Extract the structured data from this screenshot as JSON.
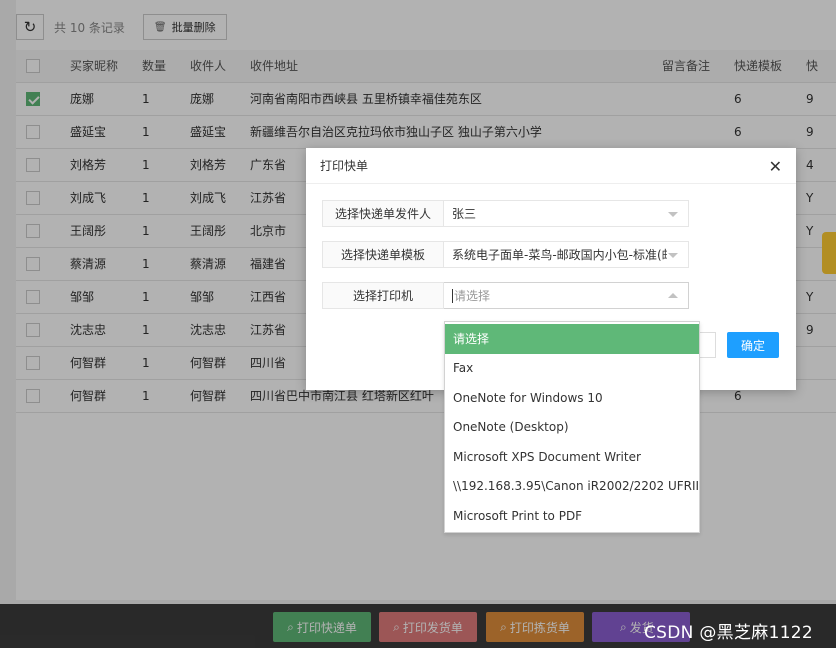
{
  "toolbar": {
    "refresh_icon": "refresh-icon",
    "record_count": "共 10 条记录",
    "batch_delete_icon": "trash-icon",
    "batch_delete_label": "批量删除"
  },
  "table": {
    "headers": [
      "买家昵称",
      "数量",
      "收件人",
      "收件地址",
      "留言备注",
      "快递模板",
      "快"
    ],
    "rows": [
      {
        "checked": true,
        "nickname": "庞娜",
        "qty": "1",
        "recipient": "庞娜",
        "address": "河南省南阳市西峡县 五里桥镇幸福佳苑东区",
        "note": "",
        "template": "6",
        "extra": "9"
      },
      {
        "checked": false,
        "nickname": "盛延宝",
        "qty": "1",
        "recipient": "盛延宝",
        "address": "新疆维吾尔自治区克拉玛依市独山子区 独山子第六小学",
        "note": "",
        "template": "6",
        "extra": "9"
      },
      {
        "checked": false,
        "nickname": "刘格芳",
        "qty": "1",
        "recipient": "刘格芳",
        "address": "广东省",
        "note": "",
        "template": "",
        "extra": "4"
      },
      {
        "checked": false,
        "nickname": "刘成飞",
        "qty": "1",
        "recipient": "刘成飞",
        "address": "江苏省",
        "note": "",
        "template": "",
        "extra": "Y"
      },
      {
        "checked": false,
        "nickname": "王阔彤",
        "qty": "1",
        "recipient": "王阔彤",
        "address": "北京市",
        "note": "",
        "template": "",
        "extra": "Y"
      },
      {
        "checked": false,
        "nickname": "蔡清源",
        "qty": "1",
        "recipient": "蔡清源",
        "address": "福建省",
        "note": "",
        "template": "",
        "extra": ""
      },
      {
        "checked": false,
        "nickname": "邹邹",
        "qty": "1",
        "recipient": "邹邹",
        "address": "江西省",
        "note": "",
        "template": "",
        "extra": "Y"
      },
      {
        "checked": false,
        "nickname": "沈志忠",
        "qty": "1",
        "recipient": "沈志忠",
        "address": "江苏省",
        "note": "",
        "template": "",
        "extra": "9"
      },
      {
        "checked": false,
        "nickname": "何智群",
        "qty": "1",
        "recipient": "何智群",
        "address": "四川省",
        "note": "",
        "template": "",
        "extra": ""
      },
      {
        "checked": false,
        "nickname": "何智群",
        "qty": "1",
        "recipient": "何智群",
        "address": "四川省巴中市南江县 红塔新区红叶",
        "note": "",
        "template": "6",
        "extra": ""
      }
    ]
  },
  "dialog": {
    "title": "打印快单",
    "close_icon": "close-icon",
    "sender_label": "选择快递单发件人",
    "sender_value": "张三",
    "template_label": "选择快递单模板",
    "template_value": "系统电子面单-菜鸟-邮政国内小包-标准(邮",
    "printer_label": "选择打印机",
    "printer_placeholder": "请选择",
    "ok_label": "确定",
    "printer_options": [
      "请选择",
      "Fax",
      "OneNote for Windows 10",
      "OneNote (Desktop)",
      "Microsoft XPS Document Writer",
      "\\\\192.168.3.95\\Canon iR2002/2202 UFRII LT",
      "Microsoft Print to PDF"
    ],
    "selected_option_index": 0
  },
  "bottom_buttons": [
    {
      "label": "打印快递单",
      "color": "#5fb878",
      "icon": "search-icon"
    },
    {
      "label": "打印发货单",
      "color": "#e07c7c",
      "icon": "search-icon"
    },
    {
      "label": "打印拣货单",
      "color": "#e08f3c",
      "icon": "search-icon"
    },
    {
      "label": "发货",
      "color": "#8c5fd1",
      "icon": "search-icon"
    }
  ],
  "watermark": "CSDN @黑芝麻1122",
  "colors": {
    "accent_green": "#5fb878",
    "ok_blue": "#1e9fff",
    "side_tab": "#ffcc33"
  }
}
